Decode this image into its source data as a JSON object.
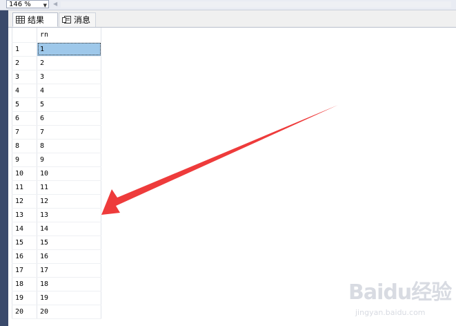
{
  "toolbar": {
    "zoom_value": "146 %"
  },
  "tabs": [
    {
      "label": "结果",
      "icon": "grid-icon"
    },
    {
      "label": "消息",
      "icon": "messages-icon"
    }
  ],
  "grid": {
    "columns": [
      "rn"
    ],
    "rows": [
      {
        "num": "1",
        "rn": "1"
      },
      {
        "num": "2",
        "rn": "2"
      },
      {
        "num": "3",
        "rn": "3"
      },
      {
        "num": "4",
        "rn": "4"
      },
      {
        "num": "5",
        "rn": "5"
      },
      {
        "num": "6",
        "rn": "6"
      },
      {
        "num": "7",
        "rn": "7"
      },
      {
        "num": "8",
        "rn": "8"
      },
      {
        "num": "9",
        "rn": "9"
      },
      {
        "num": "10",
        "rn": "10"
      },
      {
        "num": "11",
        "rn": "11"
      },
      {
        "num": "12",
        "rn": "12"
      },
      {
        "num": "13",
        "rn": "13"
      },
      {
        "num": "14",
        "rn": "14"
      },
      {
        "num": "15",
        "rn": "15"
      },
      {
        "num": "16",
        "rn": "16"
      },
      {
        "num": "17",
        "rn": "17"
      },
      {
        "num": "18",
        "rn": "18"
      },
      {
        "num": "19",
        "rn": "19"
      },
      {
        "num": "20",
        "rn": "20"
      }
    ]
  },
  "watermark": {
    "logo": "Baidu经验",
    "url": "jingyan.baidu.com"
  },
  "colors": {
    "selection": "#9ec8ea",
    "annotation_arrow": "#ee3b3b",
    "sidebar": "#3a4a6b"
  }
}
